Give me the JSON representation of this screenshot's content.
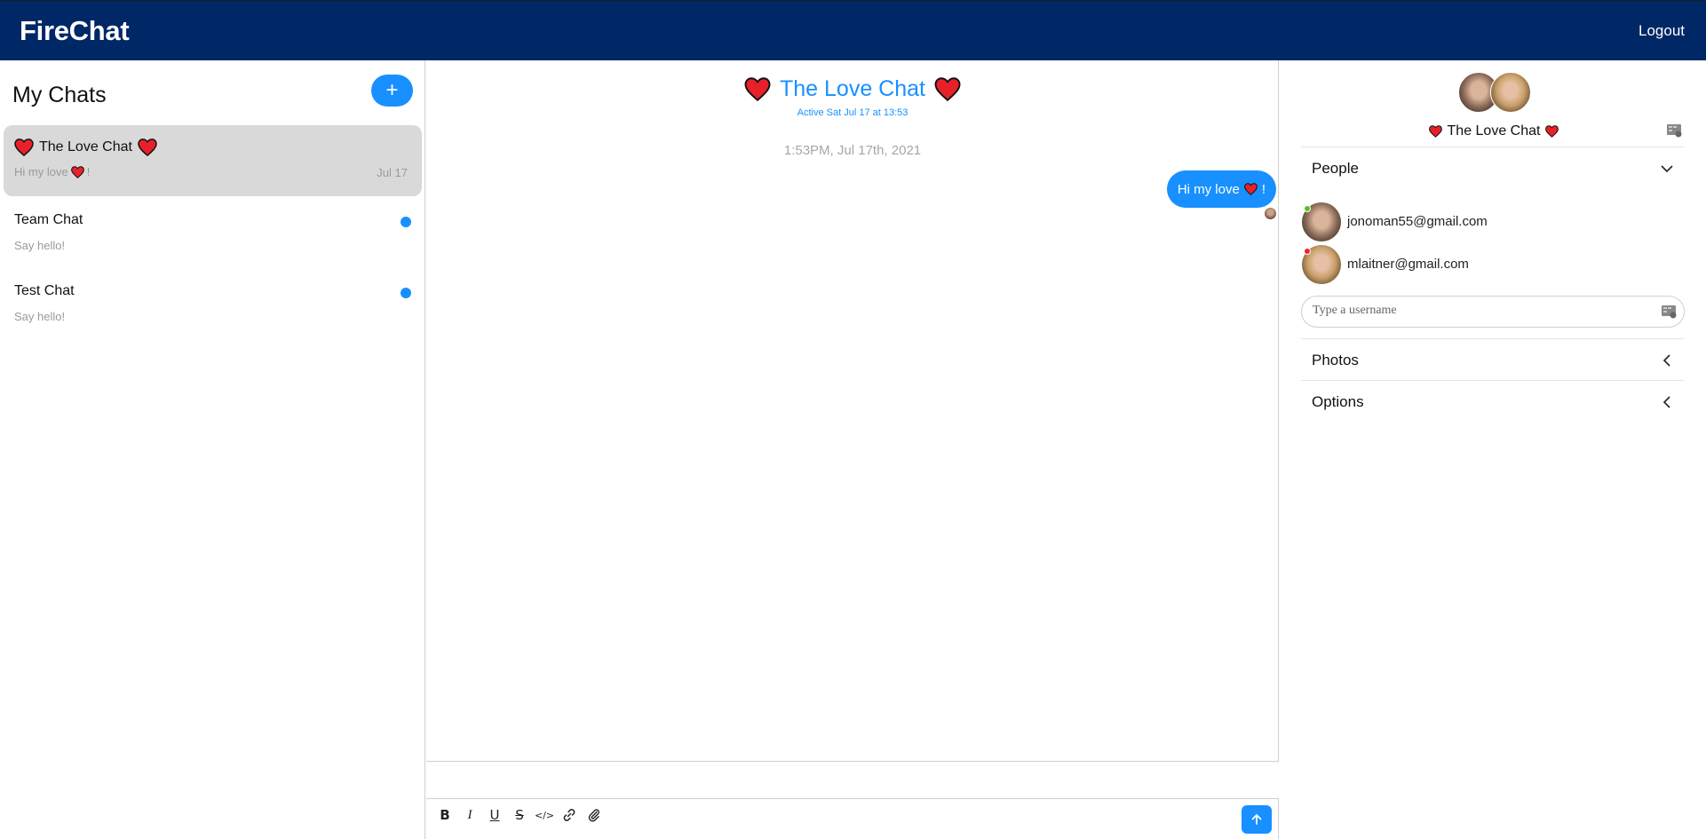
{
  "header": {
    "brand": "FireChat",
    "logout_label": "Logout"
  },
  "sidebar": {
    "title": "My Chats",
    "new_chat_icon": "+",
    "chats": [
      {
        "title": "The Love Chat",
        "preview": "Hi my love",
        "preview_suffix": "!",
        "date": "Jul 17",
        "active": true,
        "unread": false
      },
      {
        "title": "Team Chat",
        "preview": "Say hello!",
        "date": "",
        "active": false,
        "unread": true
      },
      {
        "title": "Test Chat",
        "preview": "Say hello!",
        "date": "",
        "active": false,
        "unread": true
      }
    ]
  },
  "chat": {
    "title": "The Love Chat",
    "active_status": "Active Sat Jul 17 at 13:53",
    "timestamp": "1:53PM, Jul 17th, 2021",
    "messages": [
      {
        "text": "Hi my love",
        "suffix": "!",
        "mine": true
      }
    ],
    "composer": {
      "tools": [
        "bold-icon",
        "italic-icon",
        "underline-icon",
        "strikethrough-icon",
        "code-icon",
        "link-icon",
        "attachment-icon"
      ],
      "tool_glyphs": {
        "bold": "B",
        "italic": "I",
        "underline": "U",
        "strike": "S",
        "code": "</>"
      }
    }
  },
  "settings": {
    "title": "The Love Chat",
    "sections": {
      "people": "People",
      "photos": "Photos",
      "options": "Options"
    },
    "people": [
      {
        "email": "jonoman55@gmail.com",
        "online": true
      },
      {
        "email": "mlaitner@gmail.com",
        "online": false
      }
    ],
    "username_placeholder": "Type a username"
  },
  "colors": {
    "topbar": "#002766",
    "accent": "#1890ff",
    "active_card": "#d9d9d9",
    "online": "#52c41a",
    "offline": "#f5222d",
    "heart": "#e8202a"
  }
}
